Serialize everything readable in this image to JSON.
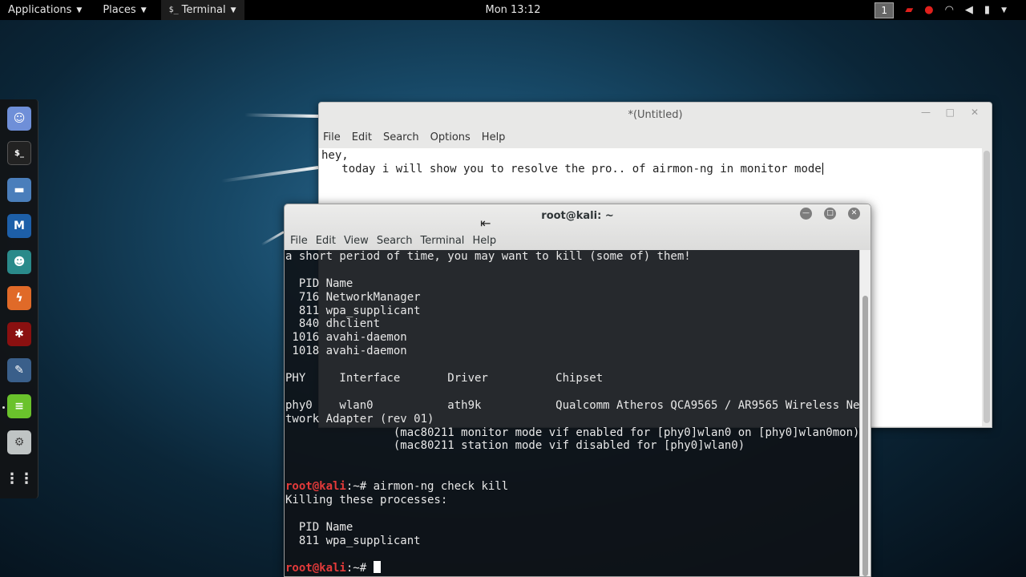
{
  "topbar": {
    "applications": "Applications",
    "places": "Places",
    "terminal_icon": "$_",
    "terminal": "Terminal",
    "clock": "Mon 13:12",
    "workspace": "1"
  },
  "dock": {
    "items": [
      "ghost-app-icon",
      "terminal-icon",
      "files-icon",
      "metasploit-icon",
      "armitage-icon",
      "burp-icon",
      "faraday-icon",
      "maltego-icon",
      "text-editor-icon",
      "settings-icon",
      "app-grid-icon"
    ]
  },
  "gedit": {
    "title": "*(Untitled)",
    "menu": [
      "File",
      "Edit",
      "Search",
      "Options",
      "Help"
    ],
    "text_line1": "hey,",
    "text_line2": "   today i will show you to resolve the pro.. of airmon-ng in monitor mode"
  },
  "terminal": {
    "title": "root@kali: ~",
    "menu": [
      "File",
      "Edit",
      "View",
      "Search",
      "Terminal",
      "Help"
    ],
    "lines": [
      "a short period of time, you may want to kill (some of) them!",
      "",
      "  PID Name",
      "  716 NetworkManager",
      "  811 wpa_supplicant",
      "  840 dhclient",
      " 1016 avahi-daemon",
      " 1018 avahi-daemon",
      "",
      "PHY     Interface       Driver          Chipset",
      "",
      "phy0    wlan0           ath9k           Qualcomm Atheros QCA9565 / AR9565 Wireless Ne",
      "twork Adapter (rev 01)",
      "                (mac80211 monitor mode vif enabled for [phy0]wlan0 on [phy0]wlan0mon)",
      "                (mac80211 station mode vif disabled for [phy0]wlan0)",
      "",
      ""
    ],
    "prompt_user": "root@kali",
    "prompt_rest": ":~# ",
    "command": "airmon-ng check kill",
    "lines2": [
      "Killing these processes:",
      "",
      "  PID Name",
      "  811 wpa_supplicant",
      ""
    ]
  }
}
